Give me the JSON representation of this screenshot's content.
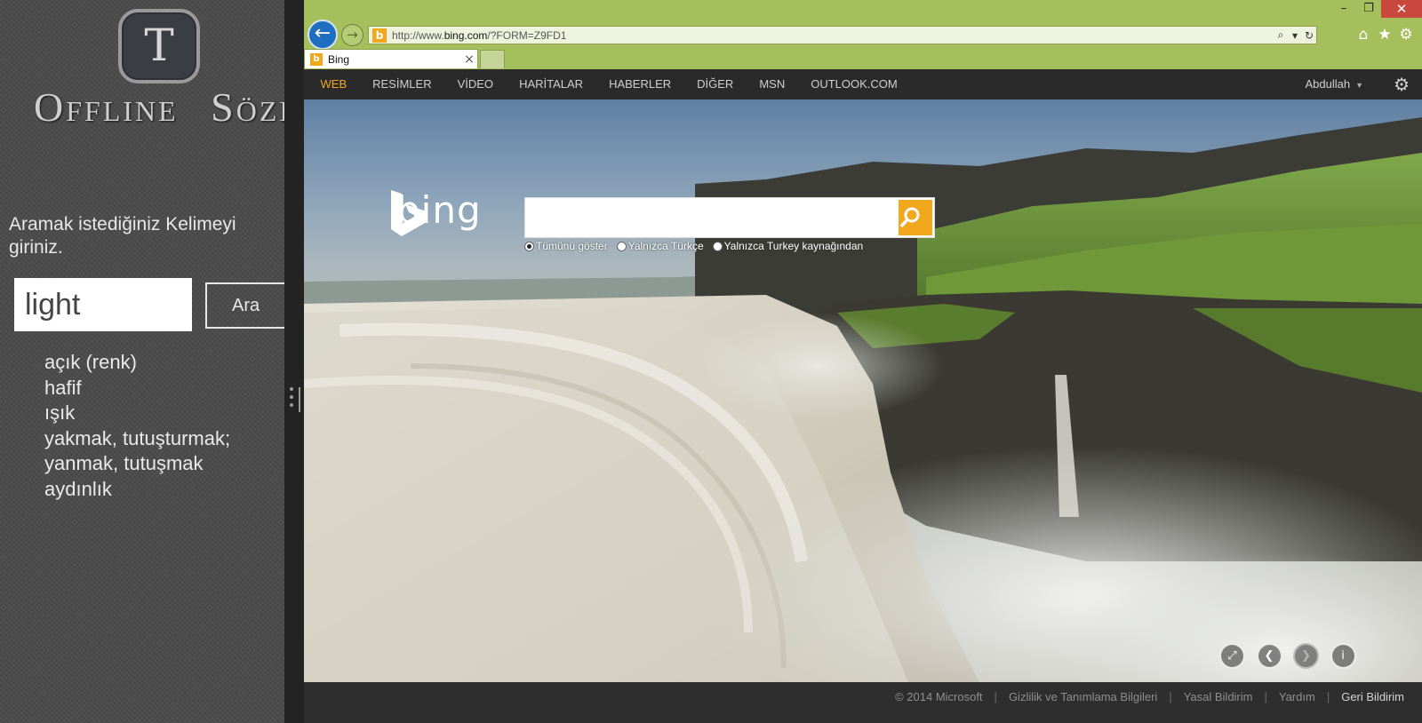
{
  "left_app": {
    "logo_letter": "T",
    "title": "Offline Sözlük",
    "prompt": "Aramak istediğiniz Kelimeyi giriniz.",
    "search_value": "light",
    "search_button": "Ara",
    "results": [
      "açık (renk)",
      "hafif",
      "ışık",
      "yakmak, tutuşturmak;",
      "yanmak, tutuşmak",
      "aydınlık"
    ]
  },
  "browser": {
    "window_controls": {
      "minimize": "–",
      "restore": "❐",
      "close": "✕"
    },
    "address": {
      "prefix": "http://www.",
      "domain": "bing.com",
      "suffix": "/?FORM=Z9FD1"
    },
    "tab_title": "Bing",
    "tab_close": "×",
    "favicon": "b",
    "accent_color": "#a4bf5b"
  },
  "bing": {
    "nav": [
      "WEB",
      "RESİMLER",
      "VİDEO",
      "HARİTALAR",
      "HABERLER",
      "DİĞER",
      "MSN",
      "OUTLOOK.COM"
    ],
    "active_nav": "WEB",
    "user": "Abdullah",
    "logo_text": "bing",
    "search_value": "",
    "radios": [
      {
        "label": "Tümünü göster",
        "checked": true
      },
      {
        "label": "Yalnızca Türkçe",
        "checked": false
      },
      {
        "label": "Yalnızca Turkey kaynağından",
        "checked": false
      }
    ],
    "brand_color": "#f1a81c",
    "footer": {
      "copyright": "© 2014 Microsoft",
      "links": [
        "Gizlilik ve Tanımlama Bilgileri",
        "Yasal Bildirim",
        "Yardım"
      ],
      "feedback": "Geri Bildirim"
    }
  }
}
